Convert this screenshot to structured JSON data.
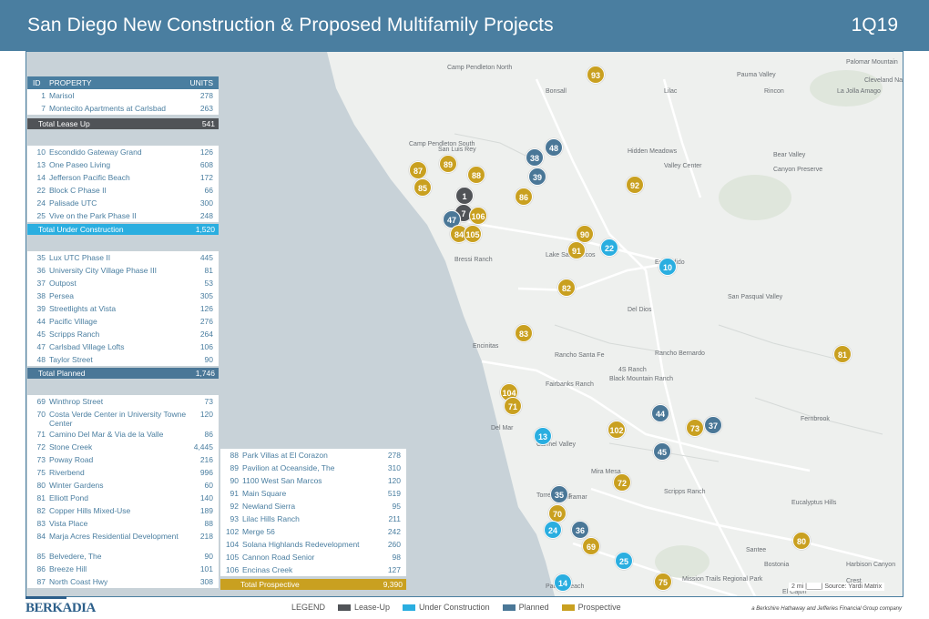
{
  "header": {
    "title": "San Diego  New Construction & Proposed Multifamily Projects",
    "quarter": "1Q19"
  },
  "colors": {
    "lease_up": "#505357",
    "under_construction": "#2aaee0",
    "planned": "#4a7797",
    "prospective": "#c9a020",
    "header": "#4a7ea0"
  },
  "table": {
    "col_id": "ID",
    "col_property": "PROPERTY",
    "col_units": "UNITS",
    "lease_up": [
      {
        "id": "1",
        "name": "Marisol",
        "units": "278"
      },
      {
        "id": "7",
        "name": "Montecito Apartments at Carlsbad",
        "units": "263"
      }
    ],
    "lease_up_total": {
      "label": "Total Lease Up",
      "units": "541"
    },
    "under_construction": [
      {
        "id": "10",
        "name": "Escondido Gateway Grand",
        "units": "126"
      },
      {
        "id": "13",
        "name": "One Paseo Living",
        "units": "608"
      },
      {
        "id": "14",
        "name": "Jefferson Pacific Beach",
        "units": "172"
      },
      {
        "id": "22",
        "name": "Block C Phase II",
        "units": "66"
      },
      {
        "id": "24",
        "name": "Palisade UTC",
        "units": "300"
      },
      {
        "id": "25",
        "name": "Vive on the Park Phase II",
        "units": "248"
      }
    ],
    "under_construction_total": {
      "label": "Total Under Construction",
      "units": "1,520"
    },
    "planned": [
      {
        "id": "35",
        "name": "Lux UTC Phase II",
        "units": "445"
      },
      {
        "id": "36",
        "name": "University City Village Phase III",
        "units": "81"
      },
      {
        "id": "37",
        "name": "Outpost",
        "units": "53"
      },
      {
        "id": "38",
        "name": "Persea",
        "units": "305"
      },
      {
        "id": "39",
        "name": "Streetlights at Vista",
        "units": "126"
      },
      {
        "id": "44",
        "name": "Pacific Village",
        "units": "276"
      },
      {
        "id": "45",
        "name": "Scripps Ranch",
        "units": "264"
      },
      {
        "id": "47",
        "name": "Carlsbad Village Lofts",
        "units": "106"
      },
      {
        "id": "48",
        "name": "Taylor Street",
        "units": "90"
      }
    ],
    "planned_total": {
      "label": "Total Planned",
      "units": "1,746"
    },
    "prospective_a": [
      {
        "id": "69",
        "name": "Winthrop Street",
        "units": "73"
      },
      {
        "id": "70",
        "name": "Costa Verde Center in University Towne Center",
        "units": "120"
      },
      {
        "id": "71",
        "name": "Camino Del Mar & Via de la Valle",
        "units": "86"
      },
      {
        "id": "72",
        "name": "Stone Creek",
        "units": "4,445"
      },
      {
        "id": "73",
        "name": "Poway Road",
        "units": "216"
      },
      {
        "id": "75",
        "name": "Riverbend",
        "units": "996"
      },
      {
        "id": "80",
        "name": "Winter Gardens",
        "units": "60"
      },
      {
        "id": "81",
        "name": "Elliott Pond",
        "units": "140"
      },
      {
        "id": "82",
        "name": "Copper Hills Mixed-Use",
        "units": "189"
      },
      {
        "id": "83",
        "name": "Vista Place",
        "units": "88"
      },
      {
        "id": "84",
        "name": "Marja Acres Residential Development",
        "units": "218"
      },
      {
        "id": "85",
        "name": "Belvedere, The",
        "units": "90"
      },
      {
        "id": "86",
        "name": "Breeze Hill",
        "units": "101"
      },
      {
        "id": "87",
        "name": "North Coast Hwy",
        "units": "308"
      }
    ],
    "prospective_b": [
      {
        "id": "88",
        "name": "Park Villas at El Corazon",
        "units": "278"
      },
      {
        "id": "89",
        "name": "Pavilion at Oceanside, The",
        "units": "310"
      },
      {
        "id": "90",
        "name": "1100 West San Marcos",
        "units": "120"
      },
      {
        "id": "91",
        "name": "Main Square",
        "units": "519"
      },
      {
        "id": "92",
        "name": "Newland Sierra",
        "units": "95"
      },
      {
        "id": "93",
        "name": "Lilac Hills Ranch",
        "units": "211"
      },
      {
        "id": "102",
        "name": "Merge 56",
        "units": "242"
      },
      {
        "id": "104",
        "name": "Solana Highlands Redevelopment",
        "units": "260"
      },
      {
        "id": "105",
        "name": "Cannon Road Senior",
        "units": "98"
      },
      {
        "id": "106",
        "name": "Encinas Creek",
        "units": "127"
      }
    ],
    "prospective_total": {
      "label": "Total Prospective",
      "units": "9,390"
    }
  },
  "map": {
    "places": [
      "Camp Pendleton North",
      "Bonsall",
      "Lilac",
      "Pauma Valley",
      "Rincon",
      "La Jolla Amago",
      "Cleveland National",
      "Palomar Mountain",
      "Camp Pendleton South",
      "San Luis Rey",
      "Hidden Meadows",
      "Valley Center",
      "Bear Valley",
      "Canyon Preserve",
      "Lake San Marcos",
      "Escondido",
      "San Pasqual Valley",
      "Del Dios",
      "Encinitas",
      "Rancho Santa Fe",
      "Fairbanks Ranch",
      "Black Mountain Ranch",
      "Rancho Bernardo",
      "Fernbrook",
      "Del Mar",
      "Carmel Valley",
      "Mira Mesa",
      "Scripps Ranch",
      "Miramar",
      "Eucalyptus Hills",
      "Santee",
      "Bostonia",
      "Harbison Canyon",
      "Mission Trails Regional Park",
      "Crest",
      "El Cajon",
      "4S Ranch",
      "Bressi Ranch",
      "Torrey Pines",
      "Pacific Beach"
    ],
    "markers": [
      {
        "id": "93",
        "status": "prospective"
      },
      {
        "id": "48",
        "status": "planned"
      },
      {
        "id": "38",
        "status": "planned"
      },
      {
        "id": "87",
        "status": "prospective"
      },
      {
        "id": "89",
        "status": "prospective"
      },
      {
        "id": "88",
        "status": "prospective"
      },
      {
        "id": "39",
        "status": "planned"
      },
      {
        "id": "85",
        "status": "prospective"
      },
      {
        "id": "92",
        "status": "prospective"
      },
      {
        "id": "1",
        "status": "lease_up"
      },
      {
        "id": "86",
        "status": "prospective"
      },
      {
        "id": "7",
        "status": "lease_up"
      },
      {
        "id": "106",
        "status": "prospective"
      },
      {
        "id": "47",
        "status": "planned"
      },
      {
        "id": "84",
        "status": "prospective"
      },
      {
        "id": "105",
        "status": "prospective"
      },
      {
        "id": "90",
        "status": "prospective"
      },
      {
        "id": "91",
        "status": "prospective"
      },
      {
        "id": "22",
        "status": "under_construction"
      },
      {
        "id": "10",
        "status": "under_construction"
      },
      {
        "id": "82",
        "status": "prospective"
      },
      {
        "id": "83",
        "status": "prospective"
      },
      {
        "id": "81",
        "status": "prospective"
      },
      {
        "id": "104",
        "status": "prospective"
      },
      {
        "id": "71",
        "status": "prospective"
      },
      {
        "id": "44",
        "status": "planned"
      },
      {
        "id": "102",
        "status": "prospective"
      },
      {
        "id": "73",
        "status": "prospective"
      },
      {
        "id": "37",
        "status": "planned"
      },
      {
        "id": "13",
        "status": "under_construction"
      },
      {
        "id": "45",
        "status": "planned"
      },
      {
        "id": "72",
        "status": "prospective"
      },
      {
        "id": "35",
        "status": "planned"
      },
      {
        "id": "70",
        "status": "prospective"
      },
      {
        "id": "24",
        "status": "under_construction"
      },
      {
        "id": "36",
        "status": "planned"
      },
      {
        "id": "80",
        "status": "prospective"
      },
      {
        "id": "69",
        "status": "prospective"
      },
      {
        "id": "25",
        "status": "under_construction"
      },
      {
        "id": "14",
        "status": "under_construction"
      },
      {
        "id": "75",
        "status": "prospective"
      }
    ],
    "scale": "2 mi",
    "source": "Source: Yardi Matrix"
  },
  "legend": {
    "title": "LEGEND",
    "lease_up": "Lease-Up",
    "under_construction": "Under Construction",
    "planned": "Planned",
    "prospective": "Prospective"
  },
  "footer": {
    "logo": "BERKADIA",
    "tagline": "a Berkshire Hathaway and Jefferies Financial Group company"
  }
}
